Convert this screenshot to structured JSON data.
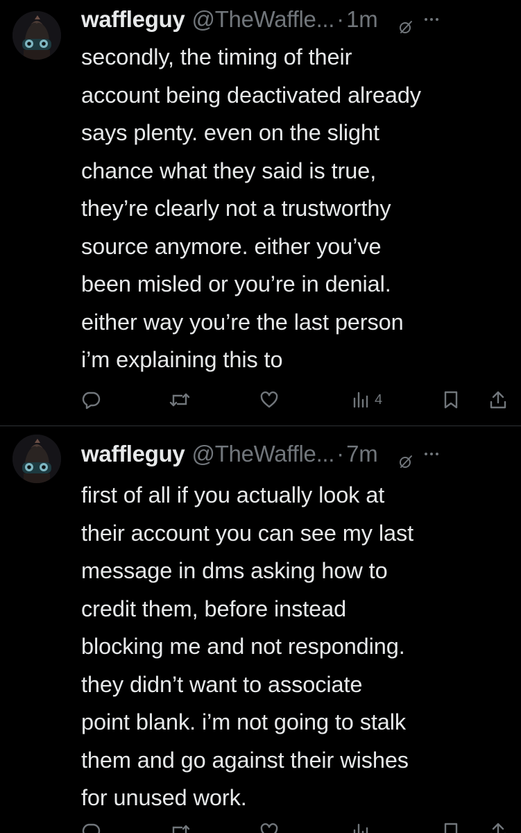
{
  "tweets": [
    {
      "display_name": "waffleguy",
      "handle": "@TheWaffle...",
      "separator": "·",
      "time": "1m",
      "text": "secondly, the timing of their\naccount being deactivated already\nsays plenty. even on the slight\nchance what they said is true,\nthey’re clearly not a trustworthy\nsource anymore. either you’ve\nbeen misled or you’re in denial.\neither way you’re the last person\ni’m explaining this to",
      "views": "4"
    },
    {
      "display_name": "waffleguy",
      "handle": "@TheWaffle...",
      "separator": "·",
      "time": "7m",
      "text": "first of all if you actually look at\ntheir account you can see my last\nmessage in dms asking how to\ncredit them, before instead\nblocking me and not responding.\nthey didn’t want to associate\npoint blank. i’m not going to stalk\nthem and go against their wishes\nfor unused work."
    }
  ],
  "colors": {
    "background": "#000000",
    "text_primary": "#e7e9ea",
    "text_secondary": "#71767b",
    "divider": "#2f3336"
  },
  "icons": [
    "avatar-image",
    "grok-icon",
    "more-icon",
    "reply-icon",
    "retweet-icon",
    "like-icon",
    "views-icon",
    "bookmark-icon",
    "share-icon"
  ]
}
